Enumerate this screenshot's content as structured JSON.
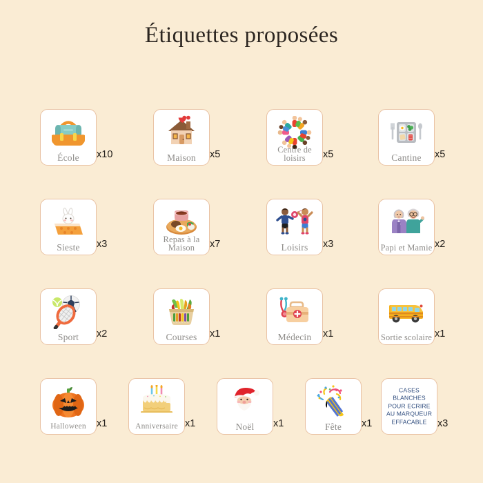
{
  "page": {
    "title": "Étiquettes proposées",
    "background_color": "#faecd4",
    "card_background": "#ffffff",
    "card_border_color": "#e9c2a4",
    "label_color": "#8e8c89",
    "quantity_color": "#24201c",
    "blank_card_text_color": "#2c4a7c"
  },
  "rows": [
    {
      "cards": [
        {
          "label": "École",
          "quantity": "x10",
          "icon": "school-backpack-icon"
        },
        {
          "label": "Maison",
          "quantity": "x5",
          "icon": "house-with-heart-icon"
        },
        {
          "label": "Centre de\nloisirs",
          "quantity": "x5",
          "icon": "children-circle-icon"
        },
        {
          "label": "Cantine",
          "quantity": "x5",
          "icon": "lunch-tray-icon"
        }
      ]
    },
    {
      "cards": [
        {
          "label": "Sieste",
          "quantity": "x3",
          "icon": "sleeping-bunny-icon"
        },
        {
          "label": "Repas à la\nMaison",
          "quantity": "x7",
          "icon": "home-meal-plate-icon"
        },
        {
          "label": "Loisirs",
          "quantity": "x3",
          "icon": "children-playing-ball-icon"
        },
        {
          "label": "Papi et\nMamie",
          "quantity": "x2",
          "icon": "grandparents-icon"
        }
      ]
    },
    {
      "cards": [
        {
          "label": "Sport",
          "quantity": "x2",
          "icon": "sports-balls-racket-icon"
        },
        {
          "label": "Courses",
          "quantity": "x1",
          "icon": "grocery-basket-icon"
        },
        {
          "label": "Médecin",
          "quantity": "x1",
          "icon": "doctor-kit-stethoscope-icon"
        },
        {
          "label": "Sortie\nscolaire",
          "quantity": "x1",
          "icon": "school-bus-icon"
        }
      ]
    },
    {
      "cards": [
        {
          "label": "Halloween",
          "quantity": "x1",
          "icon": "jack-o-lantern-icon"
        },
        {
          "label": "Anniversaire",
          "quantity": "x1",
          "icon": "birthday-cake-icon"
        },
        {
          "label": "Noël",
          "quantity": "x1",
          "icon": "santa-claus-icon"
        },
        {
          "label": "Fête",
          "quantity": "x1",
          "icon": "party-popper-icon"
        },
        {
          "label": "",
          "quantity": "x3",
          "icon": "blank-write-on-card",
          "blank_text": "CASES\nBLANCHES\nPOUR ECRIRE\nAU MARQUEUR\nEFFACABLE"
        }
      ]
    }
  ]
}
